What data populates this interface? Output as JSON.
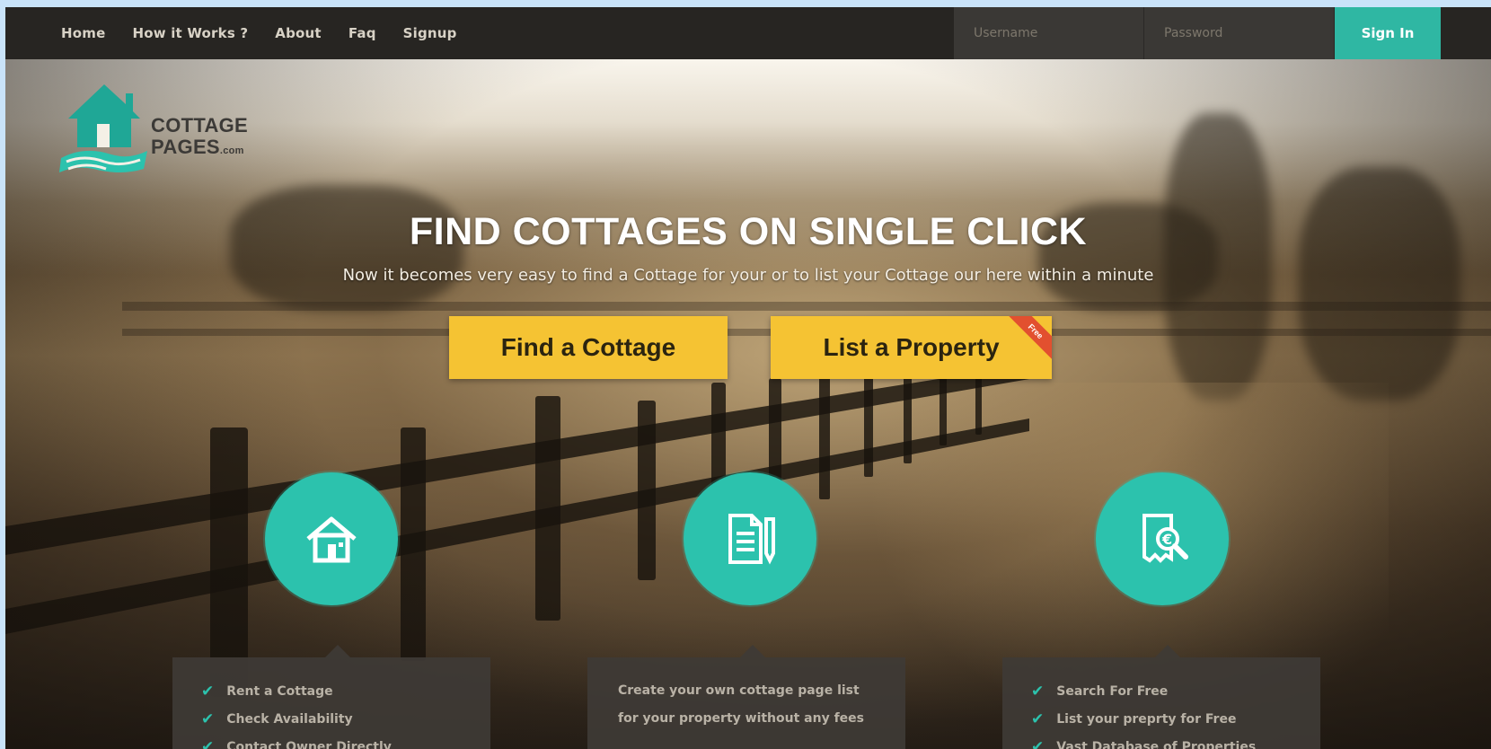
{
  "nav": {
    "items": [
      "Home",
      "How it Works ?",
      "About",
      "Faq",
      "Signup"
    ]
  },
  "login": {
    "username_placeholder": "Username",
    "password_placeholder": "Password",
    "signin_label": "Sign In"
  },
  "logo": {
    "line1": "COTTAGE",
    "line2": "PAGES",
    "suffix": ".com"
  },
  "hero": {
    "headline": "FIND COTTAGES ON SINGLE CLICK",
    "subline": "Now it becomes very easy to find a Cottage for your or to list your Cottage our here within a minute",
    "find_label": "Find a Cottage",
    "list_label": "List a Property",
    "ribbon_label": "Free"
  },
  "features": [
    {
      "icon": "house-icon",
      "items": [
        "Rent a Cottage",
        "Check Availability",
        "Contact Owner Directly"
      ]
    },
    {
      "icon": "document-pencil-icon",
      "text": "Create your own cottage page list for your property without any fees"
    },
    {
      "icon": "receipt-search-icon",
      "items": [
        "Search For Free",
        "List your preprty for Free",
        "Vast Database of Properties"
      ]
    }
  ],
  "colors": {
    "accent": "#2cc2ad",
    "cta": "#f5c333",
    "topbar": "#272522",
    "signin": "#2fb7a3"
  }
}
